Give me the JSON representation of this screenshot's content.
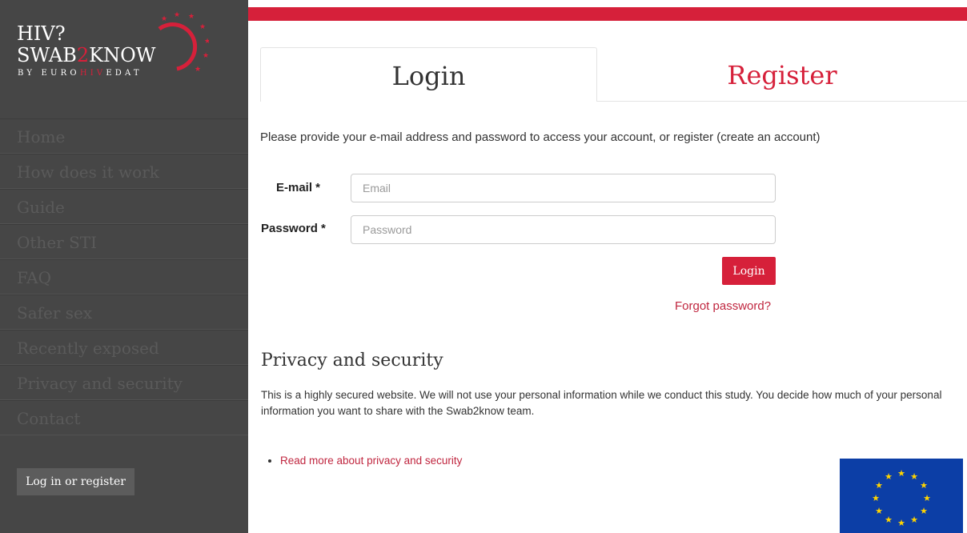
{
  "logo": {
    "line1": "HIV?",
    "line2_a": "SWAB",
    "line2_num": "2",
    "line2_b": "KNOW",
    "line3_a": "BY EURO",
    "line3_hiv": "HIV",
    "line3_b": "EDAT"
  },
  "sidebar": {
    "items": [
      {
        "label": "Home"
      },
      {
        "label": "How does it work"
      },
      {
        "label": "Guide"
      },
      {
        "label": "Other STI"
      },
      {
        "label": "FAQ"
      },
      {
        "label": "Safer sex"
      },
      {
        "label": "Recently exposed"
      },
      {
        "label": "Privacy and security"
      },
      {
        "label": "Contact"
      }
    ],
    "button_label": "Log in or register"
  },
  "tabs": {
    "login": "Login",
    "register": "Register"
  },
  "form": {
    "intro": "Please provide your e-mail address and password to access your account, or register (create an account)",
    "email_label": "E-mail *",
    "email_placeholder": "Email",
    "email_value": "",
    "password_label": "Password *",
    "password_placeholder": "Password",
    "password_value": "",
    "submit_label": "Login",
    "forgot_label": "Forgot password?"
  },
  "privacy": {
    "title": "Privacy and security",
    "text": "This is a highly secured website. We will not use your personal information while we conduct this study. You decide how much of your personal information you want to share with the Swab2know team.",
    "link": "Read more about privacy and security"
  },
  "colors": {
    "brand_red": "#d6203a",
    "sidebar_bg": "#464646",
    "eu_blue": "#0c3ea6",
    "eu_star": "#ffd400"
  },
  "icons": {
    "logo_ring": "star-ring-icon",
    "eu_flag": "eu-flag-icon"
  }
}
